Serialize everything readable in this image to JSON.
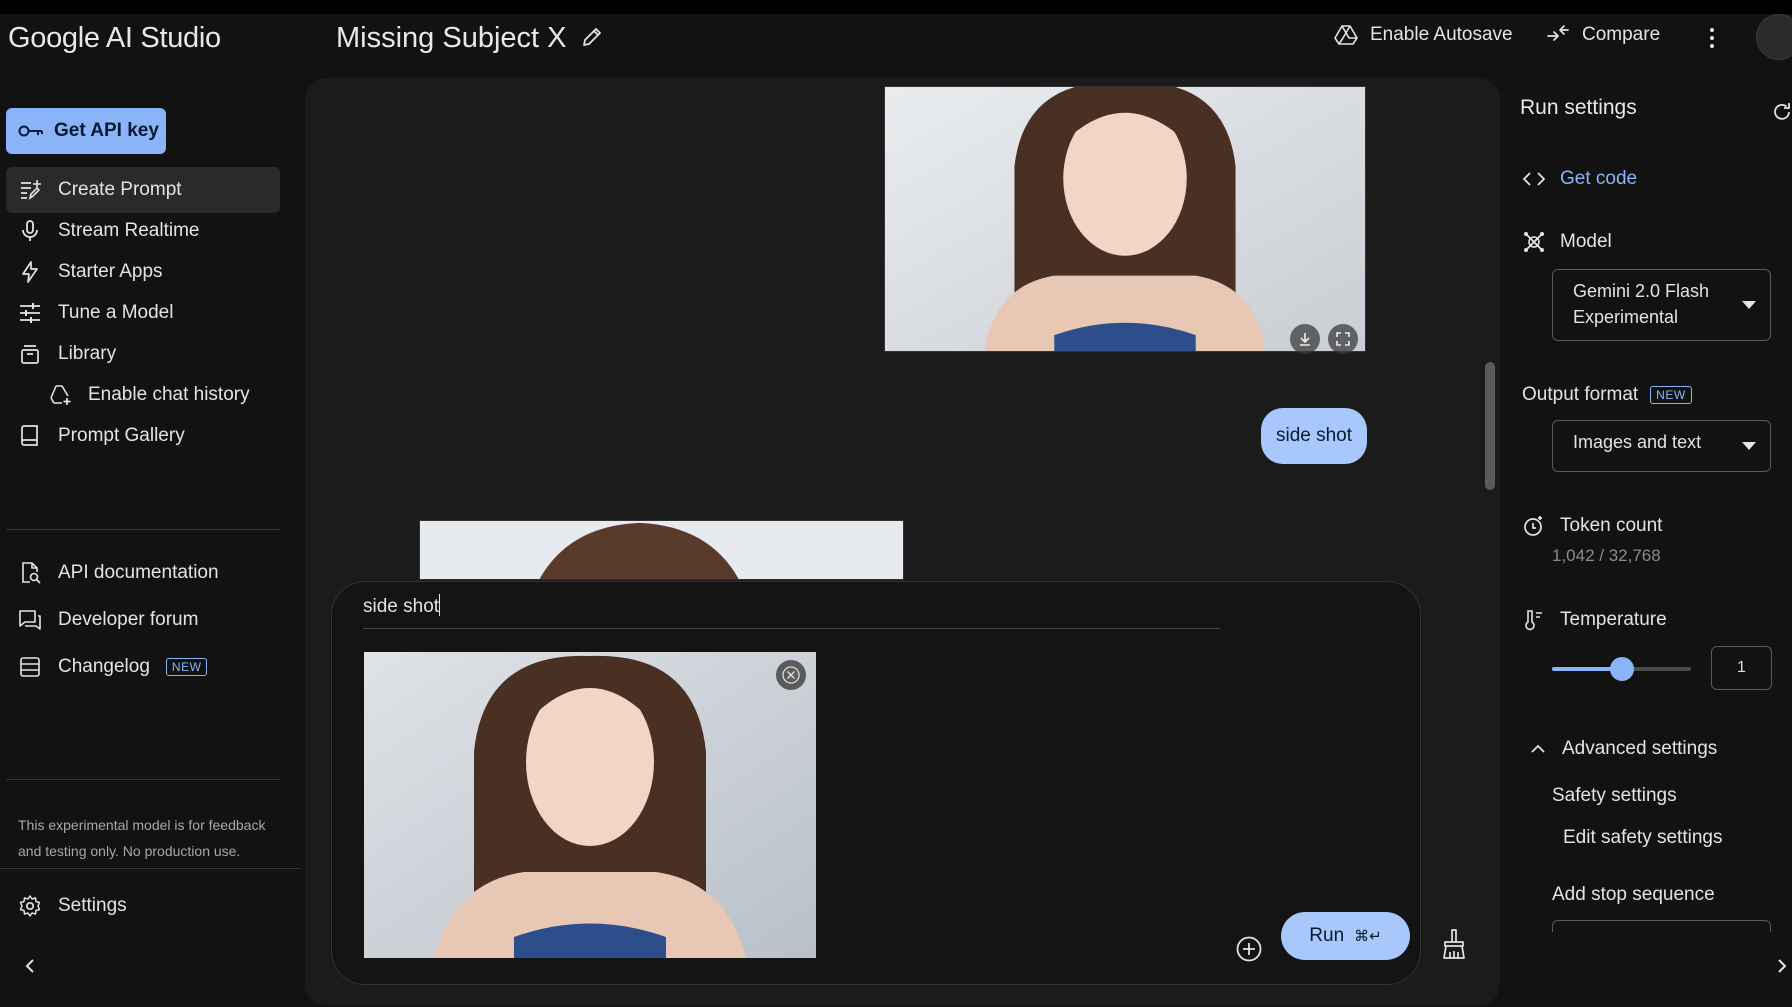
{
  "header": {
    "app_title": "Google AI Studio",
    "prompt_title": "Missing Subject X",
    "autosave_label": "Enable Autosave",
    "compare_label": "Compare"
  },
  "sidebar": {
    "api_key_label": "Get API key",
    "items": [
      {
        "label": "Create Prompt",
        "icon": "create-prompt-icon",
        "active": true
      },
      {
        "label": "Stream Realtime",
        "icon": "microphone-icon"
      },
      {
        "label": "Starter Apps",
        "icon": "bolt-icon"
      },
      {
        "label": "Tune a Model",
        "icon": "tune-icon"
      },
      {
        "label": "Library",
        "icon": "library-icon"
      },
      {
        "label": "Enable chat history",
        "icon": "drive-add-icon"
      },
      {
        "label": "Prompt Gallery",
        "icon": "book-icon"
      }
    ],
    "secondary_items": [
      {
        "label": "API documentation",
        "icon": "doc-search-icon"
      },
      {
        "label": "Developer forum",
        "icon": "forum-icon"
      },
      {
        "label": "Changelog",
        "icon": "changelog-icon",
        "badge": "NEW"
      }
    ],
    "disclaimer": "This experimental model is for feedback and testing only. No production use.",
    "settings_label": "Settings"
  },
  "chat": {
    "user_message": "side shot",
    "composer_text": "side shot",
    "run_label": "Run",
    "run_shortcut": "⌘↵"
  },
  "run_settings": {
    "title": "Run settings",
    "get_code_label": "Get code",
    "model_label": "Model",
    "model_value": "Gemini 2.0 Flash Experimental",
    "output_format_label": "Output format",
    "output_format_badge": "NEW",
    "output_format_value": "Images and text",
    "token_count_label": "Token count",
    "token_count_value": "1,042 / 32,768",
    "temperature_label": "Temperature",
    "temperature_value": "1",
    "temperature_fraction": 0.5,
    "advanced_label": "Advanced settings",
    "safety_label": "Safety settings",
    "edit_safety_label": "Edit safety settings",
    "stop_sequence_label": "Add stop sequence"
  },
  "colors": {
    "accent": "#8ab4f8",
    "bubble": "#a8c7fa",
    "background": "#121212",
    "panel": "#1b1b1b"
  }
}
